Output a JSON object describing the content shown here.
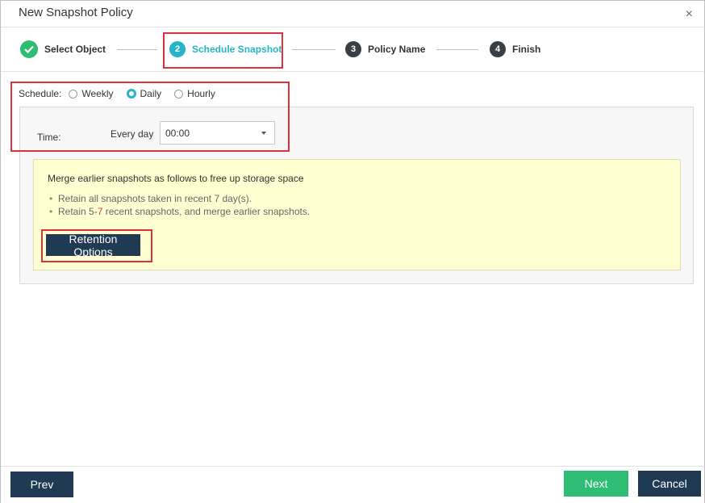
{
  "dialog": {
    "title": "New Snapshot Policy",
    "close_glyph": "×"
  },
  "steps": [
    {
      "number": "",
      "label": "Select Object",
      "state": "done",
      "icon": "check-icon"
    },
    {
      "number": "2",
      "label": "Schedule Snapshot",
      "state": "active"
    },
    {
      "number": "3",
      "label": "Policy Name",
      "state": "todo"
    },
    {
      "number": "4",
      "label": "Finish",
      "state": "todo"
    }
  ],
  "schedule": {
    "label": "Schedule:",
    "options": [
      "Weekly",
      "Daily",
      "Hourly"
    ],
    "selected": "Daily"
  },
  "time": {
    "label": "Time:",
    "every_label": "Every day",
    "value": "00:00"
  },
  "retention": {
    "title": "Merge earlier snapshots as follows to free up storage space",
    "line1": "Retain all snapshots taken in recent 7 day(s).",
    "line2_prefix": "Retain 5-",
    "line2_highlight": "7",
    "line2_suffix": " recent snapshots, and merge earlier snapshots.",
    "button_label": "Retention Options"
  },
  "footer": {
    "prev_label": "Prev",
    "next_label": "Next",
    "cancel_label": "Cancel"
  },
  "colors": {
    "accent": "#26b5c6",
    "success": "#2ebd73",
    "dark_button": "#1f3a52",
    "highlight_border": "#e0303c",
    "info_background": "#ffffd2"
  }
}
